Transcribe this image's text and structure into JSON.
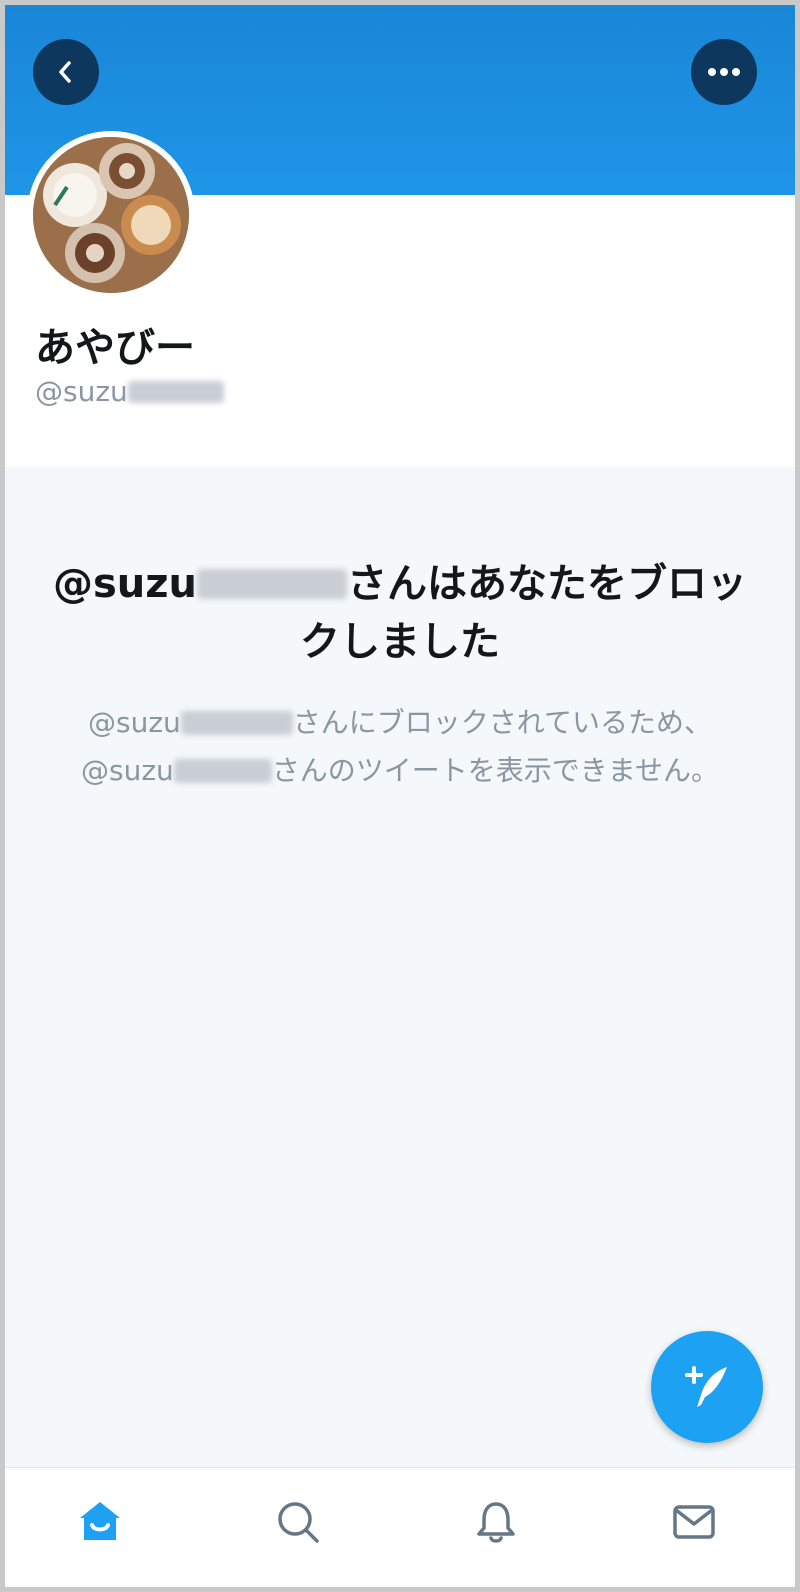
{
  "profile": {
    "display_name": "あやびー",
    "handle_prefix": "@suzu"
  },
  "blocked": {
    "title_prefix": "@suzu",
    "title_suffix": "さんはあなたをブロックしました",
    "desc_part1_prefix": "@suzu",
    "desc_part1_suffix": "さんにブロックされているため、",
    "desc_part2_prefix": "@suzu",
    "desc_part2_suffix": "さんのツイートを表示できません。"
  },
  "icons": {
    "back": "chevron-left-icon",
    "more": "ellipsis-icon",
    "compose": "feather-plus-icon",
    "home": "home-icon",
    "search": "search-icon",
    "notifications": "bell-icon",
    "messages": "mail-icon"
  },
  "colors": {
    "banner": "#1f95e8",
    "accent": "#1da1f2",
    "text_primary": "#14171a",
    "text_secondary": "#8a96a3",
    "background_area": "#f5f8fa"
  }
}
